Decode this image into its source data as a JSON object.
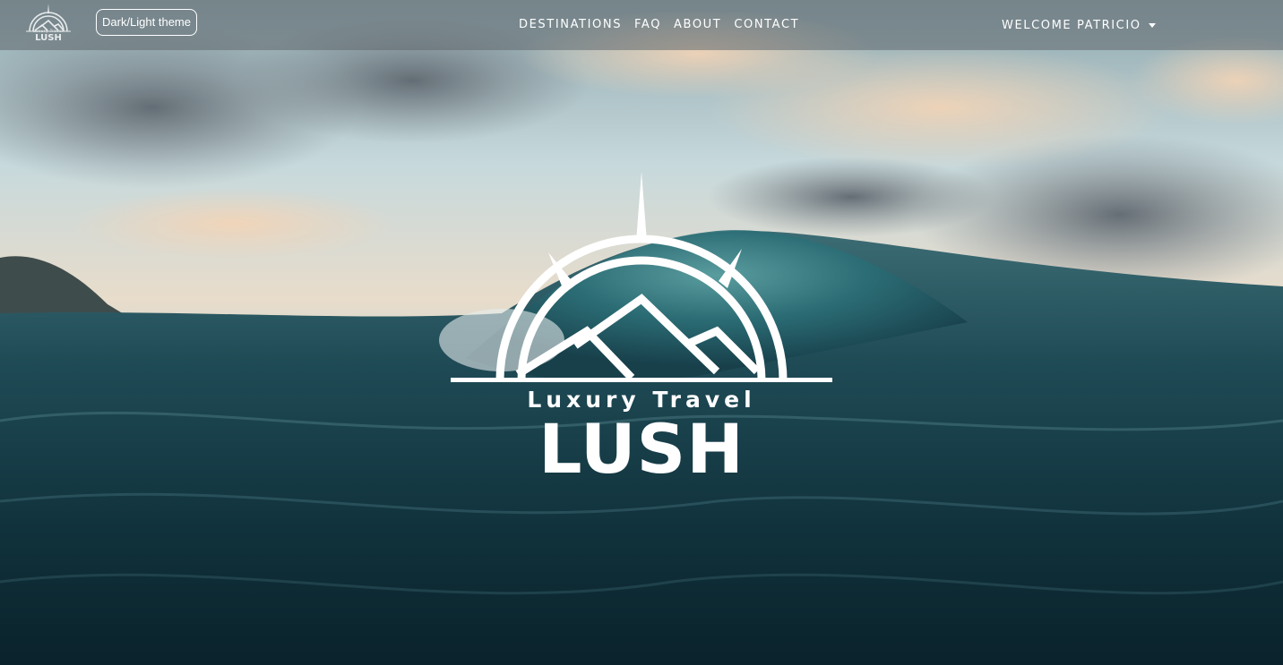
{
  "navbar": {
    "logo_icon": "compass-mountain-logo",
    "logo_small_text": "Luxury Travel",
    "logo_small_word": "LUSH",
    "theme_toggle_label": "Dark/Light theme",
    "links": [
      {
        "label": "DESTINATIONS"
      },
      {
        "label": "FAQ"
      },
      {
        "label": "ABOUT"
      },
      {
        "label": "CONTACT"
      }
    ],
    "user_menu_label": "WELCOME PATRICIO",
    "user_menu_icon": "caret-down-icon"
  },
  "hero": {
    "background": "ocean-wave-sunset-image",
    "logo_icon": "compass-mountain-logo",
    "tagline": "Luxury Travel",
    "wordmark": "LUSH"
  },
  "colors": {
    "navbar_bg": "#60686e",
    "text": "#ffffff",
    "ocean_dark": "#0e2a33",
    "sky": "#bcd6de"
  }
}
